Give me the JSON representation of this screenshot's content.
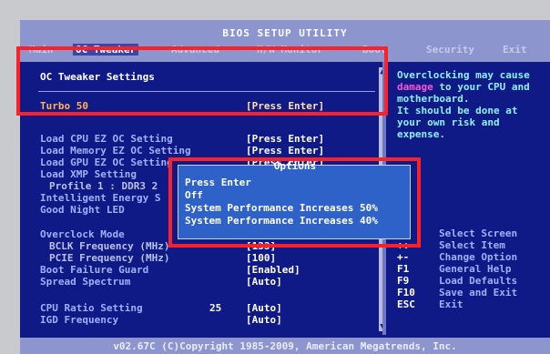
{
  "app": {
    "title": "BIOS SETUP UTILITY"
  },
  "tabs": [
    {
      "label": "Main"
    },
    {
      "label": "OC Tweaker"
    },
    {
      "label": "Advanced"
    },
    {
      "label": "H/W Monitor"
    },
    {
      "label": "Boot"
    },
    {
      "label": "Security"
    },
    {
      "label": "Exit"
    }
  ],
  "section": {
    "title": "OC Tweaker Settings"
  },
  "settings": {
    "turbo50": {
      "label": "Turbo 50",
      "value": "[Press Enter]"
    },
    "load_cpu_ez": {
      "label": "Load CPU EZ OC Setting",
      "value": "[Press Enter]"
    },
    "load_memory_ez": {
      "label": "Load Memory EZ OC Setting",
      "value": "[Press Enter]"
    },
    "load_gpu_ez": {
      "label": "Load GPU EZ OC Setting",
      "value": "[Press Enter]"
    },
    "load_xmp": {
      "label": "Load XMP Setting",
      "value": ""
    },
    "profile1": {
      "label": "Profile 1 : DDR3 2",
      "value": ""
    },
    "intelligent_energy": {
      "label": "Intelligent Energy S",
      "value": ""
    },
    "good_night_led": {
      "label": "Good Night LED",
      "value": ""
    },
    "overclock_mode": {
      "label": "Overclock Mode",
      "value": ""
    },
    "bclk": {
      "label": "BCLK Frequency (MHz)",
      "value": "[133]"
    },
    "pcie": {
      "label": "PCIE Frequency (MHz)",
      "value": "[100]"
    },
    "boot_failure_guard": {
      "label": "Boot Failure Guard",
      "value": "[Enabled]"
    },
    "spread_spectrum": {
      "label": "Spread Spectrum",
      "value": "[Auto]"
    },
    "cpu_ratio": {
      "label": "CPU Ratio Setting",
      "number": "25",
      "value": "[Auto]"
    },
    "igd_frequency": {
      "label": "IGD Frequency",
      "value": "[Auto]"
    }
  },
  "help": {
    "line1": "Overclocking may cause",
    "line2_a": "damage",
    "line2_b": " to your CPU and",
    "line3": "motherboard.",
    "line4": "It should be done at",
    "line5": "your own risk and",
    "line6": "expense."
  },
  "keys": [
    {
      "key": "←→",
      "desc": "Select Screen"
    },
    {
      "key": "↑↓",
      "desc": "Select Item"
    },
    {
      "key": "+-",
      "desc": "Change Option"
    },
    {
      "key": "F1",
      "desc": "General Help"
    },
    {
      "key": "F9",
      "desc": "Load Defaults"
    },
    {
      "key": "F10",
      "desc": "Save and Exit"
    },
    {
      "key": "ESC",
      "desc": "Exit"
    }
  ],
  "options_popup": {
    "title": "Options",
    "items": [
      "Press Enter",
      "Off",
      "System Performance Increases 50%",
      "System Performance Increases 40%"
    ]
  },
  "footer": {
    "copyright": "v02.67C (C)Copyright 1985-2009, American Megatrends, Inc."
  },
  "colors": {
    "screen_bg": "#0f1a86",
    "bar_bg": "#8d95cf",
    "popup_bg": "#2f62c9",
    "highlight_border": "#ff2028",
    "label_text": "#9fb1ff",
    "value_text": "#ffffff",
    "help_text": "#8ef0ff",
    "warning_text": "#ff54d6"
  }
}
